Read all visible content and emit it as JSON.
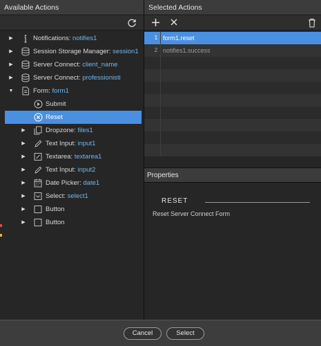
{
  "available": {
    "title": "Available Actions",
    "tree": [
      {
        "label": "Notifications: ",
        "value": "notifies1",
        "icon": "info-icon",
        "indent": 0,
        "arrow": "▶",
        "name": "notifications"
      },
      {
        "label": "Session Storage Manager: ",
        "value": "session1",
        "icon": "database-icon",
        "indent": 0,
        "arrow": "▶",
        "name": "session-storage"
      },
      {
        "label": "Server Connect: ",
        "value": "client_name",
        "icon": "database-icon",
        "indent": 0,
        "arrow": "▶",
        "name": "server-connect-client-name"
      },
      {
        "label": "Server Connect: ",
        "value": "professionisti",
        "icon": "database-icon",
        "indent": 0,
        "arrow": "▶",
        "name": "server-connect-professionisti"
      },
      {
        "label": "Form: ",
        "value": "form1",
        "icon": "document-icon",
        "indent": 0,
        "arrow": "▼",
        "name": "form1"
      },
      {
        "label": "Submit",
        "value": "",
        "icon": "play-icon",
        "indent": 1,
        "arrow": "",
        "name": "submit"
      },
      {
        "label": "Reset",
        "value": "",
        "icon": "reset-icon",
        "indent": 1,
        "arrow": "",
        "name": "reset",
        "selected": true
      },
      {
        "label": "Dropzone: ",
        "value": "files1",
        "icon": "copy-icon",
        "indent": 1,
        "arrow": "▶",
        "name": "dropzone"
      },
      {
        "label": "Text Input: ",
        "value": "input1",
        "icon": "pencil-icon",
        "indent": 1,
        "arrow": "▶",
        "name": "text-input-1"
      },
      {
        "label": "Textarea: ",
        "value": "textarea1",
        "icon": "textarea-icon",
        "indent": 1,
        "arrow": "▶",
        "name": "textarea"
      },
      {
        "label": "Text Input: ",
        "value": "input2",
        "icon": "pencil-icon",
        "indent": 1,
        "arrow": "▶",
        "name": "text-input-2"
      },
      {
        "label": "Date Picker: ",
        "value": "date1",
        "icon": "calendar-icon",
        "indent": 1,
        "arrow": "▶",
        "name": "date-picker"
      },
      {
        "label": "Select: ",
        "value": "select1",
        "icon": "select-icon",
        "indent": 1,
        "arrow": "▶",
        "name": "select"
      },
      {
        "label": "Button",
        "value": "",
        "icon": "button-icon",
        "indent": 1,
        "arrow": "▶",
        "name": "button-1"
      },
      {
        "label": "Button",
        "value": "",
        "icon": "button-icon",
        "indent": 1,
        "arrow": "▶",
        "name": "button-2"
      }
    ]
  },
  "selected": {
    "title": "Selected Actions",
    "rows": [
      {
        "num": "1",
        "text": "form1.reset",
        "active": true
      },
      {
        "num": "2",
        "text": "notifies1.success",
        "active": false
      },
      {
        "num": "",
        "text": ""
      },
      {
        "num": "",
        "text": ""
      },
      {
        "num": "",
        "text": ""
      },
      {
        "num": "",
        "text": ""
      },
      {
        "num": "",
        "text": ""
      },
      {
        "num": "",
        "text": ""
      },
      {
        "num": "",
        "text": ""
      },
      {
        "num": "",
        "text": ""
      }
    ]
  },
  "properties": {
    "title": "Properties",
    "section": "RESET",
    "description": "Reset Server Connect Form"
  },
  "footer": {
    "cancel": "Cancel",
    "select": "Select"
  },
  "colors": {
    "accent": "#4a90e2",
    "value_text": "#6fb7f0"
  }
}
